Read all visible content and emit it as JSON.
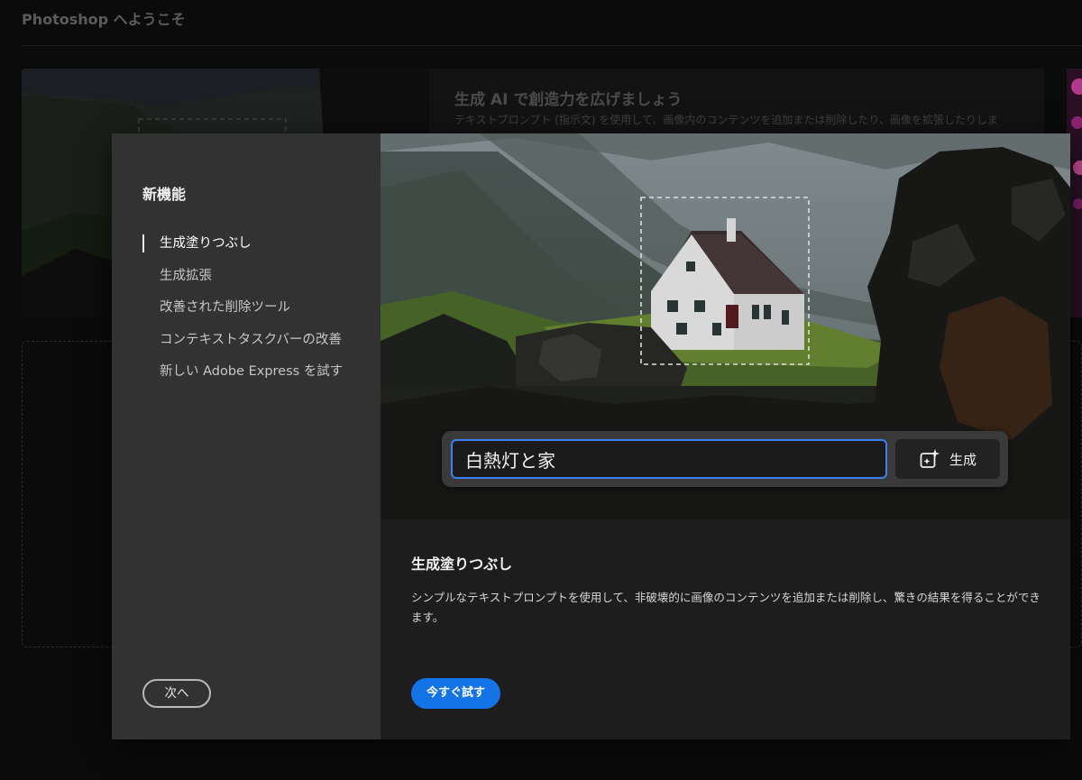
{
  "background": {
    "title": "Photoshop へようこそ",
    "card_title": "生成 AI で創造力を広げましょう",
    "card_desc": "テキストプロンプト (指示文) を使用して、画像内のコンテンツを追加または削除したり、画像を拡張したりしま"
  },
  "dialog": {
    "heading": "新機能",
    "nav_items": [
      {
        "label": "生成塗りつぶし",
        "active": true
      },
      {
        "label": "生成拡張",
        "active": false
      },
      {
        "label": "改善された削除ツール",
        "active": false
      },
      {
        "label": "コンテキストタスクバーの改善",
        "active": false
      },
      {
        "label": "新しい Adobe Express を試す",
        "active": false
      }
    ],
    "next_label": "次へ",
    "prompt_value": "白熱灯と家",
    "generate_label": "生成",
    "feature_title": "生成塗りつぶし",
    "feature_desc": "シンプルなテキストプロンプトを使用して、非破壊的に画像のコンテンツを追加または削除し、驚きの結果を得ることができます。",
    "try_label": "今すぐ試す"
  },
  "colors": {
    "accent": "#1473e6",
    "input_border": "#3b82f0",
    "nav_bg": "#323232",
    "modal_bg": "#1d1d1d"
  }
}
